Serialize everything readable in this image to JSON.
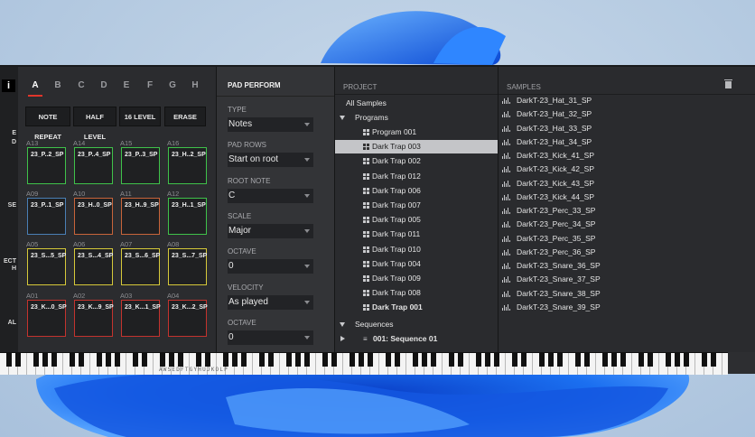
{
  "info_button": "i",
  "side_labels": [
    "E",
    "D",
    "SE",
    "ECT",
    "H",
    "AL"
  ],
  "pads": {
    "banks": [
      "A",
      "B",
      "C",
      "D",
      "E",
      "F",
      "G",
      "H"
    ],
    "active_bank": "A",
    "buttons": [
      "NOTE REPEAT",
      "HALF LEVEL",
      "16 LEVEL",
      "ERASE"
    ],
    "rows": [
      [
        {
          "id": "A13",
          "name": "23_P..2_SP",
          "color": "#3fc24a"
        },
        {
          "id": "A14",
          "name": "23_P..4_SP",
          "color": "#3fc24a"
        },
        {
          "id": "A15",
          "name": "23_P..3_SP",
          "color": "#3fc24a"
        },
        {
          "id": "A16",
          "name": "23_H..2_SP",
          "color": "#3fc24a"
        }
      ],
      [
        {
          "id": "A09",
          "name": "23_P..1_SP",
          "color": "#4a7fb5"
        },
        {
          "id": "A10",
          "name": "23_H..0_SP",
          "color": "#c8643a"
        },
        {
          "id": "A11",
          "name": "23_H..9_SP",
          "color": "#c8643a"
        },
        {
          "id": "A12",
          "name": "23_H..1_SP",
          "color": "#3fc24a"
        }
      ],
      [
        {
          "id": "A05",
          "name": "23_S...5_SP",
          "color": "#d6c93a"
        },
        {
          "id": "A06",
          "name": "23_S...4_SP",
          "color": "#d6c93a"
        },
        {
          "id": "A07",
          "name": "23_S...6_SP",
          "color": "#d6c93a"
        },
        {
          "id": "A08",
          "name": "23_S...7_SP",
          "color": "#d6c93a"
        }
      ],
      [
        {
          "id": "A01",
          "name": "23_K...0_SP",
          "color": "#c4332e"
        },
        {
          "id": "A02",
          "name": "23_K...9_SP",
          "color": "#c4332e"
        },
        {
          "id": "A03",
          "name": "23_K...1_SP",
          "color": "#c4332e"
        },
        {
          "id": "A04",
          "name": "23_K...2_SP",
          "color": "#c4332e"
        }
      ]
    ]
  },
  "perform": {
    "title": "PAD PERFORM",
    "fields": [
      {
        "label": "TYPE",
        "value": "Notes"
      },
      {
        "label": "PAD ROWS",
        "value": "Start on root"
      },
      {
        "label": "ROOT NOTE",
        "value": "C"
      },
      {
        "label": "SCALE",
        "value": "Major"
      },
      {
        "label": "OCTAVE",
        "value": "0"
      },
      {
        "label": "VELOCITY",
        "value": "As played"
      },
      {
        "label": "OCTAVE",
        "value": "0"
      }
    ]
  },
  "project": {
    "title": "PROJECT",
    "all_samples": "All Samples",
    "programs_label": "Programs",
    "programs": [
      "Program 001",
      "Dark Trap 003",
      "Dark Trap 002",
      "Dark Trap 012",
      "Dark Trap 006",
      "Dark Trap 007",
      "Dark Trap 005",
      "Dark Trap 011",
      "Dark Trap 010",
      "Dark Trap 004",
      "Dark Trap 009",
      "Dark Trap 008",
      "Dark Trap 001"
    ],
    "selected_program": "Dark Trap 003",
    "sequences_label": "Sequences",
    "sequences": [
      "001: Sequence 01"
    ]
  },
  "samples": {
    "title": "SAMPLES",
    "items": [
      "DarkT-23_Hat_31_SP",
      "DarkT-23_Hat_32_SP",
      "DarkT-23_Hat_33_SP",
      "DarkT-23_Hat_34_SP",
      "DarkT-23_Kick_41_SP",
      "DarkT-23_Kick_42_SP",
      "DarkT-23_Kick_43_SP",
      "DarkT-23_Kick_44_SP",
      "DarkT-23_Perc_33_SP",
      "DarkT-23_Perc_34_SP",
      "DarkT-23_Perc_35_SP",
      "DarkT-23_Perc_36_SP",
      "DarkT-23_Snare_36_SP",
      "DarkT-23_Snare_37_SP",
      "DarkT-23_Snare_38_SP",
      "DarkT-23_Snare_39_SP"
    ]
  },
  "keyboard": {
    "letters": "AWSEDFTGYHUJKOLP"
  },
  "colors": {
    "accent": "#e0352a",
    "panel": "#2d2e31",
    "wallpaper_bloom": "#1e6fe0"
  }
}
